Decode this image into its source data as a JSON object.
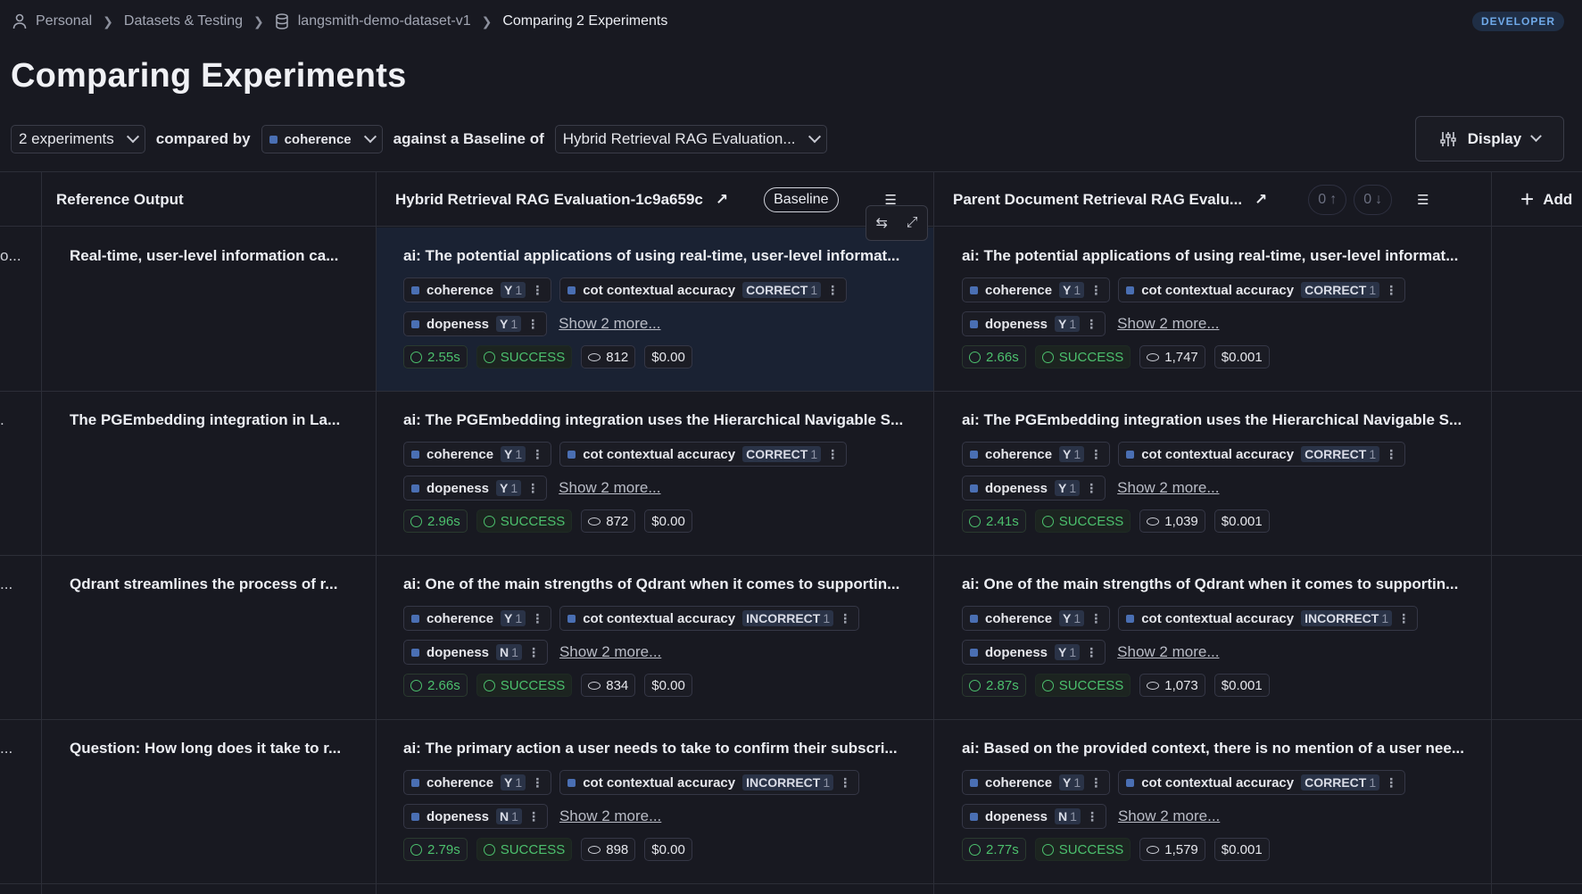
{
  "breadcrumb": {
    "items": [
      "Personal",
      "Datasets & Testing",
      "langsmith-demo-dataset-v1"
    ],
    "current": "Comparing 2 Experiments",
    "badge": "DEVELOPER"
  },
  "page_title": "Comparing Experiments",
  "controls": {
    "experiments": "2 experiments",
    "compared_by_label": "compared by",
    "metric": "coherence",
    "against_label": "against a Baseline of",
    "baseline": "Hybrid Retrieval RAG Evaluation...",
    "display": "Display"
  },
  "columns": {
    "reference": "Reference Output",
    "exp1": "Hybrid Retrieval RAG Evaluation-1c9a659c",
    "baseline_pill": "Baseline",
    "exp2": "Parent Document Retrieval RAG Evalu...",
    "votes_up": "0",
    "votes_down": "0",
    "add": "Add"
  },
  "rows": [
    {
      "left_edge": "o...",
      "reference": "Real-time, user-level information ca...",
      "exp1": {
        "output": "ai: The potential applications of using real-time, user-level informat...",
        "coherence": "Y",
        "accuracy": "CORRECT",
        "dopeness": "Y",
        "latency": "2.55s",
        "status": "SUCCESS",
        "tokens": "812",
        "cost": "$0.00"
      },
      "exp2": {
        "output": "ai: The potential applications of using real-time, user-level informat...",
        "coherence": "Y",
        "accuracy": "CORRECT",
        "dopeness": "Y",
        "latency": "2.66s",
        "status": "SUCCESS",
        "tokens": "1,747",
        "cost": "$0.001"
      }
    },
    {
      "left_edge": ".",
      "reference": "The PGEmbedding integration in La...",
      "exp1": {
        "output": "ai: The PGEmbedding integration uses the Hierarchical Navigable S...",
        "coherence": "Y",
        "accuracy": "CORRECT",
        "dopeness": "Y",
        "latency": "2.96s",
        "status": "SUCCESS",
        "tokens": "872",
        "cost": "$0.00"
      },
      "exp2": {
        "output": "ai: The PGEmbedding integration uses the Hierarchical Navigable S...",
        "coherence": "Y",
        "accuracy": "CORRECT",
        "dopeness": "Y",
        "latency": "2.41s",
        "status": "SUCCESS",
        "tokens": "1,039",
        "cost": "$0.001"
      }
    },
    {
      "left_edge": "...",
      "reference": "Qdrant streamlines the process of r...",
      "exp1": {
        "output": "ai: One of the main strengths of Qdrant when it comes to supportin...",
        "coherence": "Y",
        "accuracy": "INCORRECT",
        "dopeness": "N",
        "latency": "2.66s",
        "status": "SUCCESS",
        "tokens": "834",
        "cost": "$0.00"
      },
      "exp2": {
        "output": "ai: One of the main strengths of Qdrant when it comes to supportin...",
        "coherence": "Y",
        "accuracy": "INCORRECT",
        "dopeness": "Y",
        "latency": "2.87s",
        "status": "SUCCESS",
        "tokens": "1,073",
        "cost": "$0.001"
      }
    },
    {
      "left_edge": "...",
      "reference": "Question: How long does it take to r...",
      "exp1": {
        "output": "ai: The primary action a user needs to take to confirm their subscri...",
        "coherence": "Y",
        "accuracy": "INCORRECT",
        "dopeness": "N",
        "latency": "2.79s",
        "status": "SUCCESS",
        "tokens": "898",
        "cost": "$0.00"
      },
      "exp2": {
        "output": "ai: Based on the provided context, there is no mention of a user nee...",
        "coherence": "Y",
        "accuracy": "CORRECT",
        "dopeness": "N",
        "latency": "2.77s",
        "status": "SUCCESS",
        "tokens": "1,579",
        "cost": "$0.001"
      }
    }
  ],
  "feedback_labels": {
    "coherence": "coherence",
    "accuracy": "cot contextual accuracy",
    "dopeness": "dopeness",
    "count": "1",
    "show_more": "Show 2 more..."
  },
  "colors": {
    "background": "#181921",
    "accent": "#4a6fb3",
    "success": "#4cc06d",
    "badge": "#6fa9e8"
  }
}
